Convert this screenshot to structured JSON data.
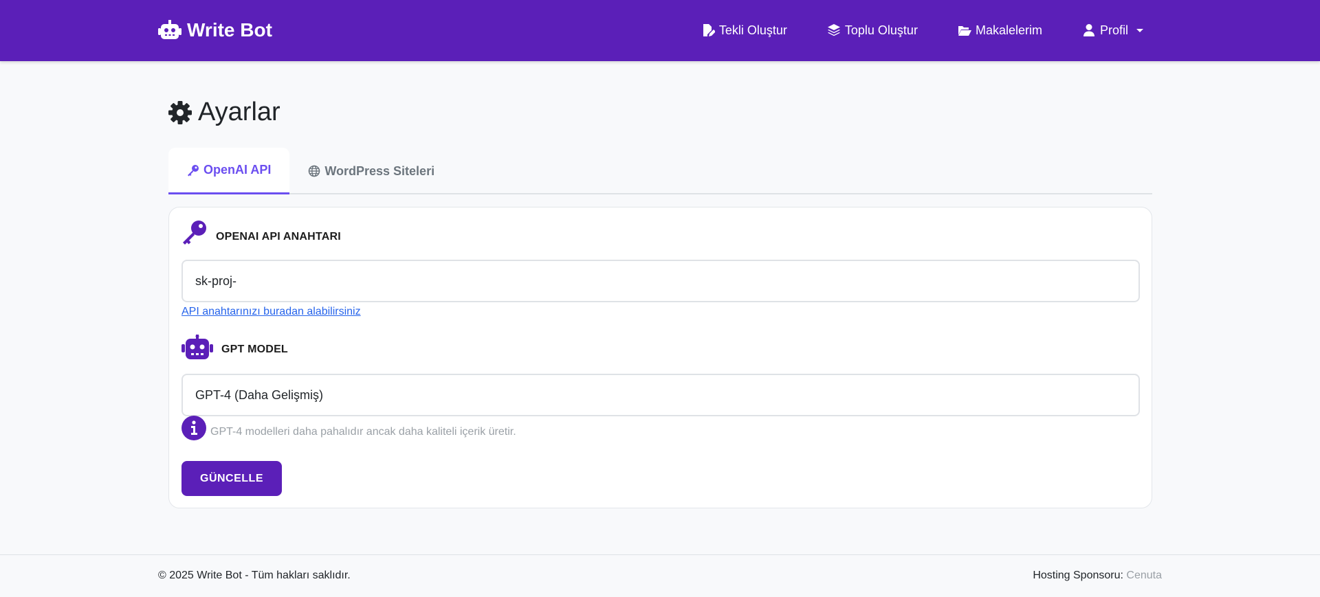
{
  "navbar": {
    "brand": "Write Bot",
    "links": [
      {
        "label": "Tekli Oluştur",
        "icon": "file-pen-icon"
      },
      {
        "label": "Toplu Oluştur",
        "icon": "layers-icon"
      },
      {
        "label": "Makalelerim",
        "icon": "folder-open-icon"
      },
      {
        "label": "Profil",
        "icon": "user-icon"
      }
    ]
  },
  "page": {
    "title": "Ayarlar"
  },
  "tabs": [
    {
      "label": "OpenAI API",
      "icon": "key-icon",
      "active": true
    },
    {
      "label": "WordPress Siteleri",
      "icon": "globe-icon",
      "active": false
    }
  ],
  "form": {
    "api_key_label": "OPENAI API ANAHTARI",
    "api_key_value": "sk-proj-",
    "api_key_help": "API anahtarınızı buradan alabilirsiniz",
    "model_label": "GPT MODEL",
    "model_value": "GPT-4 (Daha Gelişmiş)",
    "model_info": "GPT-4 modelleri daha pahalıdır ancak daha kaliteli içerik üretir.",
    "submit_label": "GÜNCELLE"
  },
  "footer": {
    "copyright": "© 2025 Write Bot - Tüm hakları saklıdır.",
    "sponsor_label": "Hosting Sponsoru:",
    "sponsor_name": "Cenuta"
  },
  "colors": {
    "primary": "#5b1fb8",
    "tab_accent": "#6b4ef0",
    "link": "#2563eb"
  }
}
